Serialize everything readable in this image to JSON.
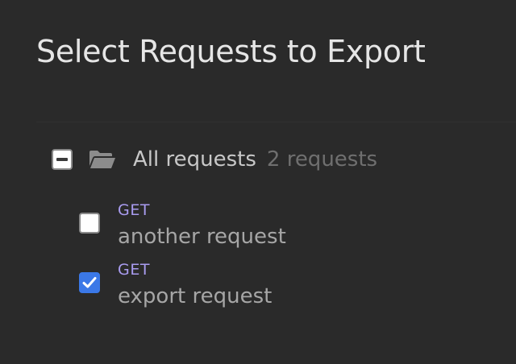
{
  "dialog": {
    "title": "Select Requests to Export"
  },
  "group": {
    "label": "All requests",
    "count": "2 requests",
    "checkbox_state": "indeterminate",
    "icon": "folder-open-icon"
  },
  "requests": [
    {
      "method": "GET",
      "name": "another request",
      "checked": false
    },
    {
      "method": "GET",
      "name": "export request",
      "checked": true
    }
  ],
  "colors": {
    "background": "#2a2a2a",
    "method": "#a99cf0",
    "checkbox_checked": "#3b78e7"
  }
}
